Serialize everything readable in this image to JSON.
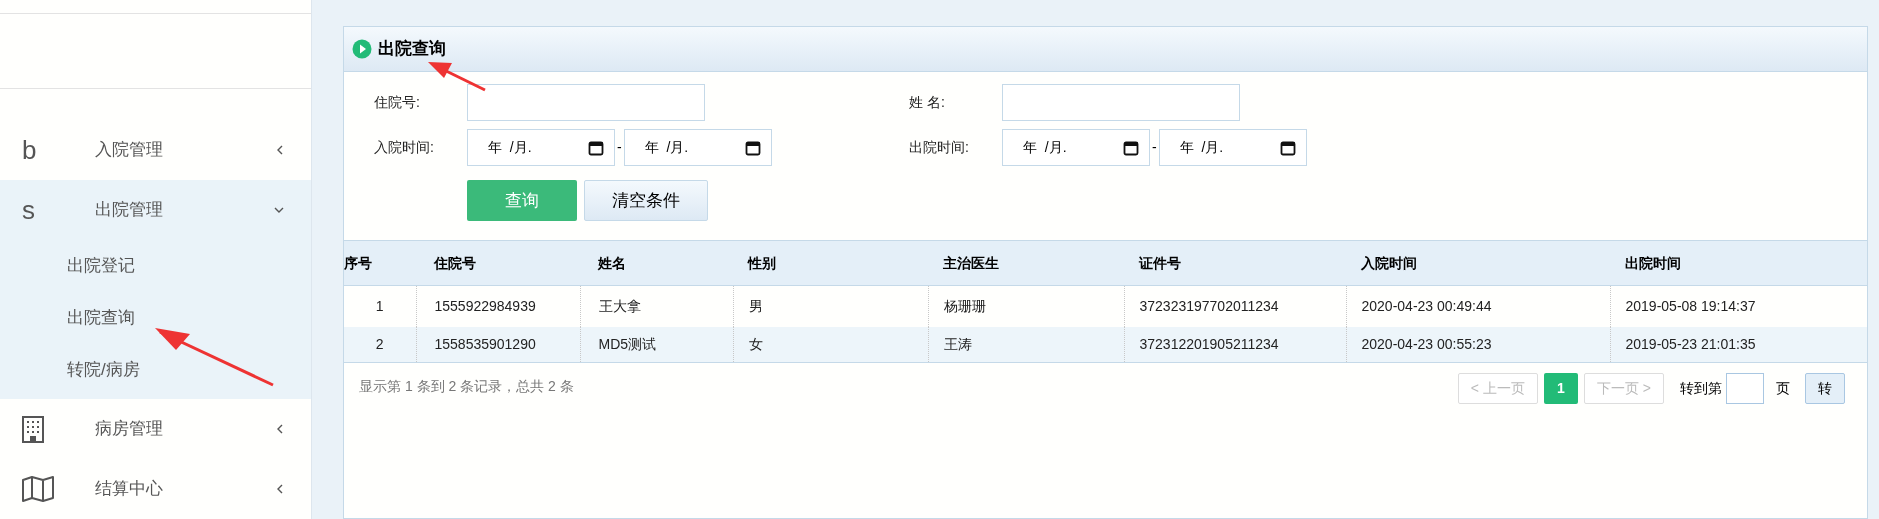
{
  "sidebar": {
    "items": [
      {
        "kind": "glyph",
        "icon_text": "b",
        "label": "入院管理",
        "expanded": false
      },
      {
        "kind": "glyph",
        "icon_text": "s",
        "label": "出院管理",
        "expanded": true,
        "children": [
          {
            "label": "出院登记"
          },
          {
            "label": "出院查询"
          },
          {
            "label": "转院/病房"
          }
        ]
      },
      {
        "kind": "building",
        "label": "病房管理",
        "expanded": false
      },
      {
        "kind": "map",
        "label": "结算中心",
        "expanded": false
      }
    ]
  },
  "panel": {
    "title": "出院查询"
  },
  "form": {
    "fields": [
      {
        "kind": "text",
        "label": "住院号:"
      },
      {
        "kind": "text",
        "label": "姓 名:"
      },
      {
        "kind": "daterange",
        "label": "入院时间:",
        "from": "年  /月.",
        "to": "年  /月.",
        "separator": "-"
      },
      {
        "kind": "daterange",
        "label": "出院时间:",
        "from": "年  /月.",
        "to": "年  /月.",
        "separator": "-"
      }
    ],
    "buttons": [
      {
        "kind": "primary",
        "label": "查询"
      },
      {
        "kind": "secondary",
        "label": "清空条件"
      }
    ]
  },
  "table": {
    "columns": [
      "序号",
      "住院号",
      "姓名",
      "性别",
      "主治医生",
      "证件号",
      "入院时间",
      "出院时间"
    ],
    "rows": [
      [
        "1",
        "1555922984939",
        "王大拿",
        "男",
        "杨珊珊",
        "372323197702011234",
        "2020-04-23 00:49:44",
        "2019-05-08 19:14:37"
      ],
      [
        "2",
        "1558535901290",
        "MD5测试",
        "女",
        "王涛",
        "372312201905211234",
        "2020-04-23 00:55:23",
        "2019-05-23 21:01:35"
      ]
    ]
  },
  "footer": {
    "summary": "显示第 1 条到 2 条记录，总共 2 条",
    "prev": {
      "label": "< 上一页",
      "disabled": true
    },
    "pages": [
      {
        "label": "1",
        "selected": true
      }
    ],
    "next": {
      "label": "下一页 >",
      "disabled": true
    },
    "goto_label": "转到第",
    "page_unit": "页",
    "go": "转"
  }
}
